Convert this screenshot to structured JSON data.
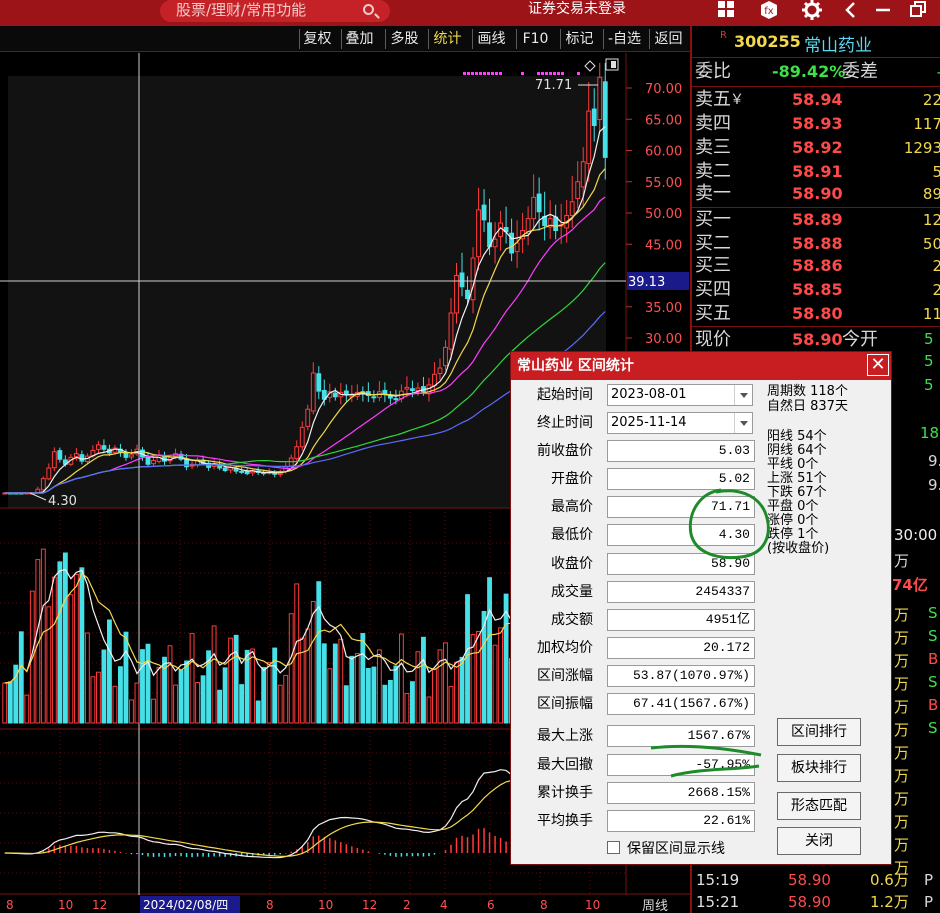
{
  "topbar": {
    "search_placeholder": "股票/理财/常用功能",
    "login_status": "证券交易未登录",
    "icons": [
      "windows-icon",
      "fx-icon",
      "gear-icon",
      "back-icon",
      "minimize-icon",
      "restore-icon"
    ]
  },
  "toolbar": {
    "buttons": [
      "复权",
      "叠加",
      "多股",
      "统计",
      "画线",
      "F10",
      "标记",
      "-自选",
      "返回"
    ],
    "active": "统计"
  },
  "stock": {
    "mark": "R",
    "code": "300255",
    "name": "常山药业"
  },
  "orderbook": {
    "webi_label": "委比",
    "webi_value": "-89.42%",
    "weicha_label": "委差",
    "weicha_value": "-",
    "asks": [
      {
        "label": "卖五",
        "price": "58.94",
        "vol": "22"
      },
      {
        "label": "卖四",
        "price": "58.93",
        "vol": "117"
      },
      {
        "label": "卖三",
        "price": "58.92",
        "vol": "1293"
      },
      {
        "label": "卖二",
        "price": "58.91",
        "vol": "5"
      },
      {
        "label": "卖一",
        "price": "58.90",
        "vol": "89"
      }
    ],
    "bids": [
      {
        "label": "买一",
        "price": "58.89",
        "vol": "12"
      },
      {
        "label": "买二",
        "price": "58.88",
        "vol": "50"
      },
      {
        "label": "买三",
        "price": "58.86",
        "vol": "2"
      },
      {
        "label": "买四",
        "price": "58.85",
        "vol": "2"
      },
      {
        "label": "买五",
        "price": "58.80",
        "vol": "11"
      }
    ],
    "ask5_suffix": "￥",
    "current_label": "现价",
    "current_price": "58.90",
    "open_label": "今开"
  },
  "ticks": [
    {
      "time": "15:19",
      "price": "58.90",
      "vol": "0.6万",
      "flag": "P"
    },
    {
      "time": "15:21",
      "price": "58.90",
      "vol": "1.2万",
      "flag": "P"
    }
  ],
  "side_fragments": {
    "time": "30:00",
    "wan": "万",
    "yi": "74亿",
    "nine_a": "9.",
    "nine_b": "9.",
    "eighteen": "18",
    "five_a": "5",
    "five_b": "5",
    "five_c": "5"
  },
  "tick_vols": [
    "万",
    "万",
    "万",
    "万",
    "万",
    "万",
    "万",
    "万",
    "万",
    "万",
    "万",
    "万"
  ],
  "tick_flags": [
    "S",
    "S",
    "B",
    "S",
    "B",
    "S"
  ],
  "dialog": {
    "title": "常山药业 区间统计",
    "start_label": "起始时间",
    "start_value": "2023-08-01",
    "end_label": "终止时间",
    "end_value": "2025-11-14",
    "fields": [
      {
        "label": "前收盘价",
        "value": "5.03"
      },
      {
        "label": "开盘价",
        "value": "5.02"
      },
      {
        "label": "最高价",
        "value": "71.71"
      },
      {
        "label": "最低价",
        "value": "4.30"
      },
      {
        "label": "收盘价",
        "value": "58.90"
      },
      {
        "label": "成交量",
        "value": "2454337"
      },
      {
        "label": "成交额",
        "value": "4951亿"
      },
      {
        "label": "加权均价",
        "value": "20.172"
      },
      {
        "label": "区间涨幅",
        "value": "53.87(1070.97%)"
      },
      {
        "label": "区间振幅",
        "value": "67.41(1567.67%)"
      },
      {
        "label": "最大上涨",
        "value": "1567.67%"
      },
      {
        "label": "最大回撤",
        "value": "-57.95%"
      },
      {
        "label": "累计换手",
        "value": "2668.15%"
      },
      {
        "label": "平均换手",
        "value": "22.61%"
      }
    ],
    "period_count": "周期数 118个",
    "natural_days": "自然日 837天",
    "stats": [
      "阳线 54个",
      "阴线 64个",
      "平线 0个",
      "上涨 51个",
      "下跌 67个",
      "平盘 0个",
      "涨停 0个",
      "跌停 1个",
      "(按收盘价)"
    ],
    "buttons": {
      "rank": "区间排行",
      "sector": "板块排行",
      "pattern": "形态匹配",
      "close": "关闭"
    },
    "checkbox_label": "保留区间显示线"
  },
  "chart_data": {
    "type": "candlestick",
    "period": "周线",
    "y_ticks": [
      70,
      65,
      60,
      55,
      50,
      45,
      35,
      30
    ],
    "y_tick_labels": [
      "70.00",
      "65.00",
      "60.00",
      "55.00",
      "50.00",
      "45.00",
      "35.00",
      "30.00"
    ],
    "crosshair_price": "39.13",
    "crosshair_date": "2024/02/08/四",
    "high_label": "71.71",
    "low_label": "4.30",
    "x_labels": [
      "8",
      "10",
      "12",
      "2024/02/08/四",
      "8",
      "10",
      "12",
      "2",
      "4",
      "6",
      "8",
      "10"
    ],
    "closes": [
      4.9,
      4.7,
      4.6,
      4.4,
      4.5,
      4.8,
      5.8,
      7.5,
      9.2,
      11.8,
      10.6,
      9.8,
      10.9,
      11.5,
      10.3,
      11.1,
      12.0,
      12.9,
      12.2,
      11.6,
      12.4,
      11.7,
      10.9,
      11.3,
      12.2,
      11.0,
      9.8,
      10.4,
      11.2,
      10.3,
      10.9,
      11.5,
      10.6,
      9.4,
      9.8,
      10.5,
      9.9,
      9.3,
      9.9,
      9.2,
      8.8,
      9.3,
      8.7,
      8.6,
      8.3,
      8.8,
      8.5,
      8.3,
      8.5,
      8.2,
      8.6,
      9.4,
      10.8,
      12.6,
      15.7,
      18.6,
      24.4,
      21.5,
      20.2,
      21.4,
      20.6,
      21.3,
      20.9,
      20.8,
      21.3,
      21.1,
      20.8,
      20.5,
      21.4,
      21.0,
      20.4,
      20.2,
      21.5,
      22.1,
      21.6,
      22.0,
      21.4,
      22.5,
      24.2,
      25.2,
      28.5,
      34.0,
      40.0,
      38.2,
      36.3,
      42.8,
      50.5,
      48.9,
      44.6,
      45.8,
      48.4,
      47.0,
      43.6,
      45.2,
      47.2,
      49.1,
      52.5,
      50.2,
      48.0,
      49.1,
      47.2,
      48.1,
      49.6,
      51.8,
      55.0,
      58.2,
      66.3,
      64.0,
      71.71,
      58.9
    ]
  }
}
